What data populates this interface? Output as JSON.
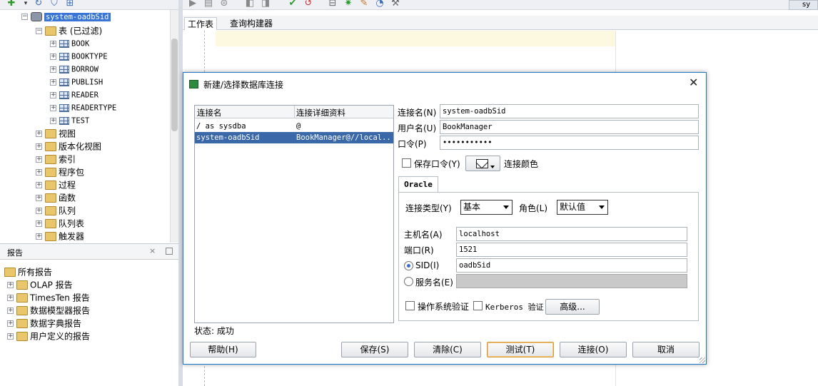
{
  "left_tree": {
    "connection": "system-oadbSid",
    "tables_node": "表 (已过滤)",
    "tables": [
      "BOOK",
      "BOOKTYPE",
      "BORROW",
      "PUBLISH",
      "READER",
      "READERTYPE",
      "TEST"
    ],
    "nodes": [
      "视图",
      "版本化视图",
      "索引",
      "程序包",
      "过程",
      "函数",
      "队列",
      "队列表",
      "触发器"
    ]
  },
  "reports": {
    "title": "报告",
    "close_glyph": "×",
    "root": "所有报告",
    "items": [
      "OLAP 报告",
      "TimesTen 报告",
      "数据模型器报告",
      "数据字典报告",
      "用户定义的报告"
    ]
  },
  "editor": {
    "tabs": [
      "工作表",
      "查询构建器"
    ],
    "connection_tab": "sy"
  },
  "dialog": {
    "title": "新建/选择数据库连接",
    "close_glyph": "✕",
    "list_headers": [
      "连接名",
      "连接详细资料"
    ],
    "connections": [
      {
        "name": "/ as sysdba",
        "details": "@"
      },
      {
        "name": "system-oadbSid",
        "details": "BookManager@//local..."
      }
    ],
    "status": "状态: 成功",
    "labels": {
      "conn_name": "连接名(N)",
      "username": "用户名(U)",
      "password": "口令(P)",
      "save_password": "保存口令(Y)",
      "conn_color": "连接颜色",
      "conn_type": "连接类型(Y)",
      "role": "角色(L)",
      "hostname": "主机名(A)",
      "port": "端口(R)",
      "sid": "SID(I)",
      "service_name": "服务名(E)",
      "os_auth": "操作系统验证",
      "kerberos": "Kerberos 验证"
    },
    "values": {
      "conn_name": "system-oadbSid",
      "username": "BookManager",
      "password": "•••••••••••",
      "conn_type": "基本",
      "role": "默认值",
      "hostname": "localhost",
      "port": "1521",
      "sid": "oadbSid",
      "service_name": ""
    },
    "tab": "Oracle",
    "buttons": {
      "advanced": "高级...",
      "help": "帮助(H)",
      "save": "保存(S)",
      "clear": "清除(C)",
      "test": "测试(T)",
      "connect": "连接(O)",
      "cancel": "取消"
    }
  }
}
